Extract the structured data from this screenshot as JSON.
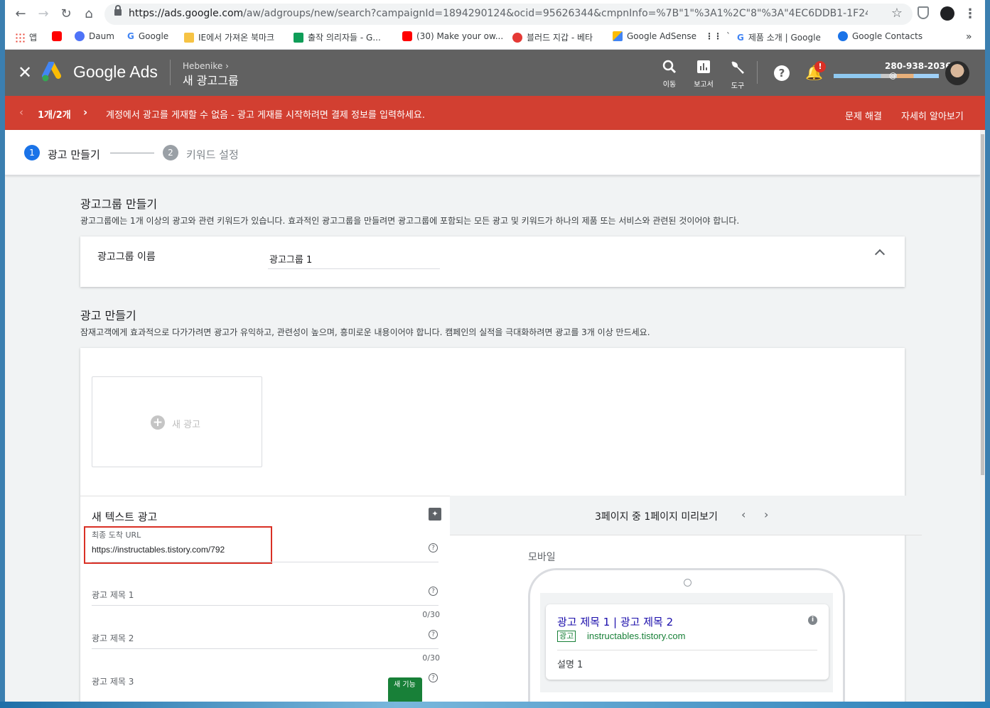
{
  "browser": {
    "url_host": "https://ads.google.com",
    "url_path": "/aw/adgroups/new/search?campaignId=1894290124&ocid=95626344&cmpnInfo=%7B\"1\"%3A1%2C\"8\"%3A\"4EC6DDB1-1F24-4FD6-9835-E...",
    "bookmarks": [
      {
        "label": "앱",
        "color": "#ea4335"
      },
      {
        "label": "",
        "color": "#ff0000"
      },
      {
        "label": "Daum",
        "color": "#4e73f8"
      },
      {
        "label": "Google",
        "color": "#4285f4"
      },
      {
        "label": "IE에서 가져온 북마크",
        "color": "#f6c344"
      },
      {
        "label": "출작 의리자들 - G...",
        "color": "#0f9d58"
      },
      {
        "label": "(30) Make your ow...",
        "color": "#ff0000"
      },
      {
        "label": "블러드 지갑 - 베타",
        "color": "#e53935"
      },
      {
        "label": "Google AdSense",
        "color": "#fbbc04"
      },
      {
        "label": "`",
        "color": "#202124"
      },
      {
        "label": "제품 소개 | Google",
        "color": "#4285f4"
      },
      {
        "label": "Google Contacts",
        "color": "#1a73e8"
      }
    ],
    "more_bookmarks": "»"
  },
  "header": {
    "brand": "Google Ads",
    "account": "Hebenike",
    "page_title": "새 광고그룹",
    "icons": [
      {
        "name": "search-icon",
        "label": "이동"
      },
      {
        "name": "reports-icon",
        "label": "보고서"
      },
      {
        "name": "tools-icon",
        "label": "도구"
      }
    ],
    "notification_badge": "!",
    "customer_id": "280-938-2036",
    "email_at": "@"
  },
  "alert": {
    "pager": "1개/2개",
    "message": "계정에서 광고를 게재할 수 없음 - 광고 게재를 시작하려면 결제 정보를 입력하세요.",
    "action_fix": "문제 해결",
    "action_learn": "자세히 알아보기",
    "color": "#d23f31"
  },
  "stepper": {
    "steps": [
      {
        "num": "1",
        "label": "광고 만들기",
        "active": true
      },
      {
        "num": "2",
        "label": "키워드 설정",
        "active": false
      }
    ]
  },
  "adgroup": {
    "title": "광고그룹 만들기",
    "desc": "광고그룹에는 1개 이상의 광고와 관련 키워드가 있습니다. 효과적인 광고그룹을 만들려면 광고그룹에 포함되는 모든 광고 및 키워드가 하나의 제품 또는 서비스와 관련된 것이어야 합니다.",
    "name_label": "광고그룹 이름",
    "name_value": "광고그룹 1"
  },
  "ads": {
    "title": "광고 만들기",
    "desc": "잠재고객에게 효과적으로 다가가려면 광고가 유익하고, 관련성이 높으며, 흥미로운 내용이어야 합니다. 캠페인의 실적을 극대화하려면 광고를 3개 이상 만드세요.",
    "new_ad": "새 광고"
  },
  "editor": {
    "title": "새 텍스트 광고",
    "final_url_label": "최종 도착 URL",
    "final_url_value": "https://instructables.tistory.com/792",
    "headline1_label": "광고 제목 1",
    "headline1_count": "0/30",
    "headline2_label": "광고 제목 2",
    "headline2_count": "0/30",
    "headline3_label": "광고 제목 3",
    "new_feature": "새 기능"
  },
  "preview": {
    "pager": "3페이지 중 1페이지 미리보기",
    "mobile_label": "모바일",
    "ad_headline": "광고 제목 1 | 광고 제목 2",
    "ad_badge": "광고",
    "ad_url": "instructables.tistory.com",
    "ad_desc": "설명 1"
  }
}
